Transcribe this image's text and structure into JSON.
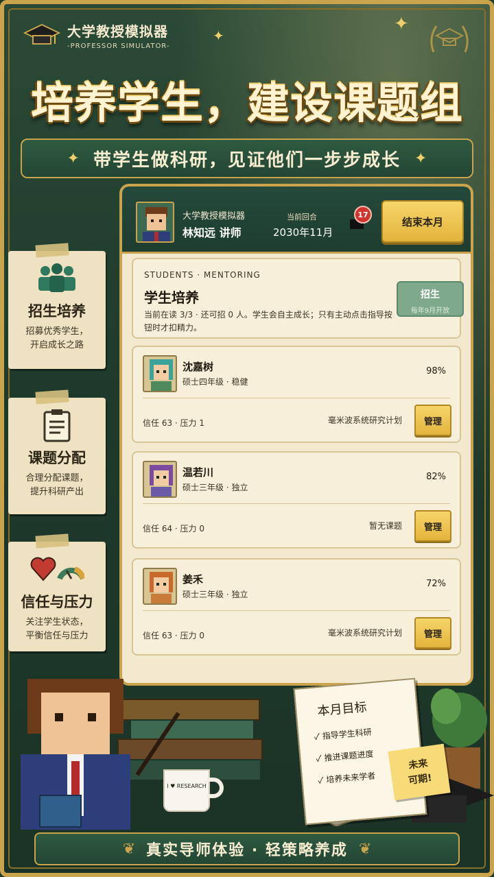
{
  "brand": {
    "title": "大学教授模拟器",
    "subtitle": "-PROFESSOR SIMULATOR-"
  },
  "headline": "培养学生，建设课题组",
  "ribbon": "带学生做科研，见证他们一步步成长",
  "features": [
    {
      "title": "招生培养",
      "desc_line1": "招募优秀学生，",
      "desc_line2": "开启成长之路",
      "icon": "students-group-icon"
    },
    {
      "title": "课题分配",
      "desc_line1": "合理分配课题，",
      "desc_line2": "提升科研产出",
      "icon": "clipboard-icon"
    },
    {
      "title": "信任与压力",
      "desc_line1": "关注学生状态，",
      "desc_line2": "平衡信任与压力",
      "icon": "heart-gauge-icon"
    }
  ],
  "topbar": {
    "game_name": "大学教授模拟器",
    "player": "林知远 讲师",
    "round_label": "当前回合",
    "round_value": "2030年11月",
    "mail_count": "17",
    "end_turn": "结束本月"
  },
  "mentoring": {
    "kicker": "STUDENTS · MENTORING",
    "title": "学生培养",
    "desc": "当前在读 3/3 · 还可招 0 人。学生会自主成长；只有主动点击指导按钮时才扣精力。",
    "recruit_label": "招生",
    "recruit_note": "每年9月开放"
  },
  "students": [
    {
      "name": "沈嘉树",
      "info": "硕士四年级 · 稳健",
      "pct": "98%",
      "stats": "信任 63 · 压力 1",
      "project": "毫米波系统研究计划",
      "manage": "管理",
      "hair": "#3aa39a"
    },
    {
      "name": "温若川",
      "info": "硕士三年级 · 独立",
      "pct": "82%",
      "stats": "信任 64 · 压力 0",
      "project": "暂无课题",
      "manage": "管理",
      "hair": "#7b4ba0"
    },
    {
      "name": "姜禾",
      "info": "硕士三年级 · 独立",
      "pct": "72%",
      "stats": "信任 63 · 压力 0",
      "project": "毫米波系统研究计划",
      "manage": "管理",
      "hair": "#c76a2b"
    }
  ],
  "notebook": {
    "title": "本月目标",
    "items": [
      "✓ 指导学生科研",
      "✓ 推进课题进度",
      "✓ 培养未来学者"
    ]
  },
  "sticky": {
    "line1": "未来",
    "line2": "可期!"
  },
  "mug_text": "I ♥ RESEARCH",
  "footer": "真实导师体验 · 轻策略养成",
  "colors": {
    "gold": "#c9a44c",
    "dark_green": "#1e3a2b",
    "paper": "#f3e9cf"
  }
}
